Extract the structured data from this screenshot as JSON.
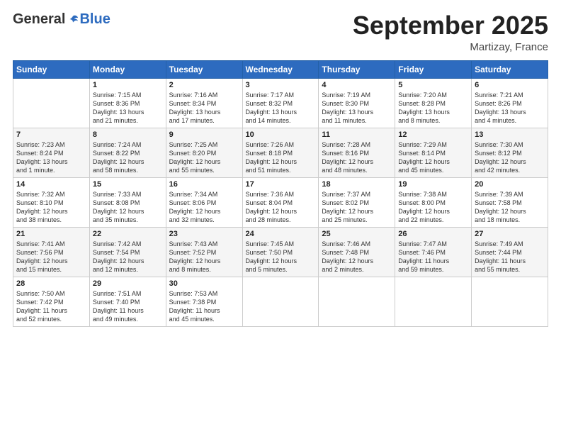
{
  "logo": {
    "general": "General",
    "blue": "Blue"
  },
  "header": {
    "month": "September 2025",
    "location": "Martizay, France"
  },
  "days_of_week": [
    "Sunday",
    "Monday",
    "Tuesday",
    "Wednesday",
    "Thursday",
    "Friday",
    "Saturday"
  ],
  "weeks": [
    [
      {
        "day": "",
        "info": ""
      },
      {
        "day": "1",
        "info": "Sunrise: 7:15 AM\nSunset: 8:36 PM\nDaylight: 13 hours\nand 21 minutes."
      },
      {
        "day": "2",
        "info": "Sunrise: 7:16 AM\nSunset: 8:34 PM\nDaylight: 13 hours\nand 17 minutes."
      },
      {
        "day": "3",
        "info": "Sunrise: 7:17 AM\nSunset: 8:32 PM\nDaylight: 13 hours\nand 14 minutes."
      },
      {
        "day": "4",
        "info": "Sunrise: 7:19 AM\nSunset: 8:30 PM\nDaylight: 13 hours\nand 11 minutes."
      },
      {
        "day": "5",
        "info": "Sunrise: 7:20 AM\nSunset: 8:28 PM\nDaylight: 13 hours\nand 8 minutes."
      },
      {
        "day": "6",
        "info": "Sunrise: 7:21 AM\nSunset: 8:26 PM\nDaylight: 13 hours\nand 4 minutes."
      }
    ],
    [
      {
        "day": "7",
        "info": "Sunrise: 7:23 AM\nSunset: 8:24 PM\nDaylight: 13 hours\nand 1 minute."
      },
      {
        "day": "8",
        "info": "Sunrise: 7:24 AM\nSunset: 8:22 PM\nDaylight: 12 hours\nand 58 minutes."
      },
      {
        "day": "9",
        "info": "Sunrise: 7:25 AM\nSunset: 8:20 PM\nDaylight: 12 hours\nand 55 minutes."
      },
      {
        "day": "10",
        "info": "Sunrise: 7:26 AM\nSunset: 8:18 PM\nDaylight: 12 hours\nand 51 minutes."
      },
      {
        "day": "11",
        "info": "Sunrise: 7:28 AM\nSunset: 8:16 PM\nDaylight: 12 hours\nand 48 minutes."
      },
      {
        "day": "12",
        "info": "Sunrise: 7:29 AM\nSunset: 8:14 PM\nDaylight: 12 hours\nand 45 minutes."
      },
      {
        "day": "13",
        "info": "Sunrise: 7:30 AM\nSunset: 8:12 PM\nDaylight: 12 hours\nand 42 minutes."
      }
    ],
    [
      {
        "day": "14",
        "info": "Sunrise: 7:32 AM\nSunset: 8:10 PM\nDaylight: 12 hours\nand 38 minutes."
      },
      {
        "day": "15",
        "info": "Sunrise: 7:33 AM\nSunset: 8:08 PM\nDaylight: 12 hours\nand 35 minutes."
      },
      {
        "day": "16",
        "info": "Sunrise: 7:34 AM\nSunset: 8:06 PM\nDaylight: 12 hours\nand 32 minutes."
      },
      {
        "day": "17",
        "info": "Sunrise: 7:36 AM\nSunset: 8:04 PM\nDaylight: 12 hours\nand 28 minutes."
      },
      {
        "day": "18",
        "info": "Sunrise: 7:37 AM\nSunset: 8:02 PM\nDaylight: 12 hours\nand 25 minutes."
      },
      {
        "day": "19",
        "info": "Sunrise: 7:38 AM\nSunset: 8:00 PM\nDaylight: 12 hours\nand 22 minutes."
      },
      {
        "day": "20",
        "info": "Sunrise: 7:39 AM\nSunset: 7:58 PM\nDaylight: 12 hours\nand 18 minutes."
      }
    ],
    [
      {
        "day": "21",
        "info": "Sunrise: 7:41 AM\nSunset: 7:56 PM\nDaylight: 12 hours\nand 15 minutes."
      },
      {
        "day": "22",
        "info": "Sunrise: 7:42 AM\nSunset: 7:54 PM\nDaylight: 12 hours\nand 12 minutes."
      },
      {
        "day": "23",
        "info": "Sunrise: 7:43 AM\nSunset: 7:52 PM\nDaylight: 12 hours\nand 8 minutes."
      },
      {
        "day": "24",
        "info": "Sunrise: 7:45 AM\nSunset: 7:50 PM\nDaylight: 12 hours\nand 5 minutes."
      },
      {
        "day": "25",
        "info": "Sunrise: 7:46 AM\nSunset: 7:48 PM\nDaylight: 12 hours\nand 2 minutes."
      },
      {
        "day": "26",
        "info": "Sunrise: 7:47 AM\nSunset: 7:46 PM\nDaylight: 11 hours\nand 59 minutes."
      },
      {
        "day": "27",
        "info": "Sunrise: 7:49 AM\nSunset: 7:44 PM\nDaylight: 11 hours\nand 55 minutes."
      }
    ],
    [
      {
        "day": "28",
        "info": "Sunrise: 7:50 AM\nSunset: 7:42 PM\nDaylight: 11 hours\nand 52 minutes."
      },
      {
        "day": "29",
        "info": "Sunrise: 7:51 AM\nSunset: 7:40 PM\nDaylight: 11 hours\nand 49 minutes."
      },
      {
        "day": "30",
        "info": "Sunrise: 7:53 AM\nSunset: 7:38 PM\nDaylight: 11 hours\nand 45 minutes."
      },
      {
        "day": "",
        "info": ""
      },
      {
        "day": "",
        "info": ""
      },
      {
        "day": "",
        "info": ""
      },
      {
        "day": "",
        "info": ""
      }
    ]
  ]
}
